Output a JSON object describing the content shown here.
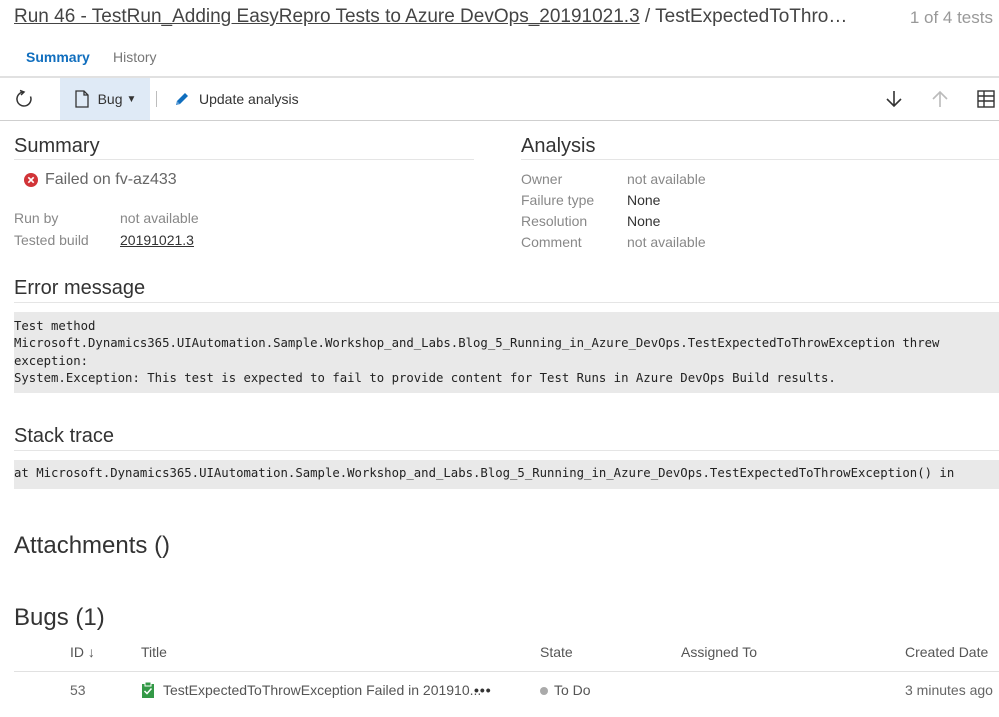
{
  "header": {
    "run_title": "Run 46 - TestRun_Adding EasyRepro Tests to Azure DevOps_20191021.3",
    "separator": " / ",
    "test_title": "TestExpectedToThro…",
    "counter": "1 of 4 tests"
  },
  "tabs": [
    {
      "label": "Summary",
      "active": true
    },
    {
      "label": "History",
      "active": false
    }
  ],
  "toolbar": {
    "refresh_icon": "refresh-icon",
    "bug_label": "Bug",
    "update_label": "Update analysis",
    "next_icon": "arrow-down-icon",
    "prev_icon": "arrow-up-icon",
    "columns_icon": "table-columns-icon"
  },
  "summary": {
    "heading": "Summary",
    "status": "Failed on fv-az433",
    "run_by_label": "Run by",
    "run_by_value": "not available",
    "tested_build_label": "Tested build",
    "tested_build_value": "20191021.3"
  },
  "analysis": {
    "heading": "Analysis",
    "owner_label": "Owner",
    "owner_value": "not available",
    "failure_type_label": "Failure type",
    "failure_type_value": "None",
    "resolution_label": "Resolution",
    "resolution_value": "None",
    "comment_label": "Comment",
    "comment_value": "not available"
  },
  "error": {
    "heading": "Error message",
    "text": "Test method\nMicrosoft.Dynamics365.UIAutomation.Sample.Workshop_and_Labs.Blog_5_Running_in_Azure_DevOps.TestExpectedToThrowException threw\nexception:\nSystem.Exception: This test is expected to fail to provide content for Test Runs in Azure DevOps Build results."
  },
  "stack": {
    "heading": "Stack trace",
    "text": "at Microsoft.Dynamics365.UIAutomation.Sample.Workshop_and_Labs.Blog_5_Running_in_Azure_DevOps.TestExpectedToThrowException() in"
  },
  "attachments": {
    "heading": "Attachments ()"
  },
  "bugs": {
    "heading": "Bugs (1)",
    "columns": [
      "ID ↓",
      "Title",
      "State",
      "Assigned To",
      "Created Date"
    ],
    "rows": [
      {
        "id": "53",
        "title": "TestExpectedToThrowException Failed in 201910...",
        "more": "•••",
        "state": "To Do",
        "assigned_to": "",
        "created": "3 minutes ago"
      }
    ]
  },
  "colors": {
    "accent": "#106ebe",
    "failed_red": "#d13438",
    "bug_green": "#339947",
    "toolbar_highlight": "#dfeaf6"
  }
}
